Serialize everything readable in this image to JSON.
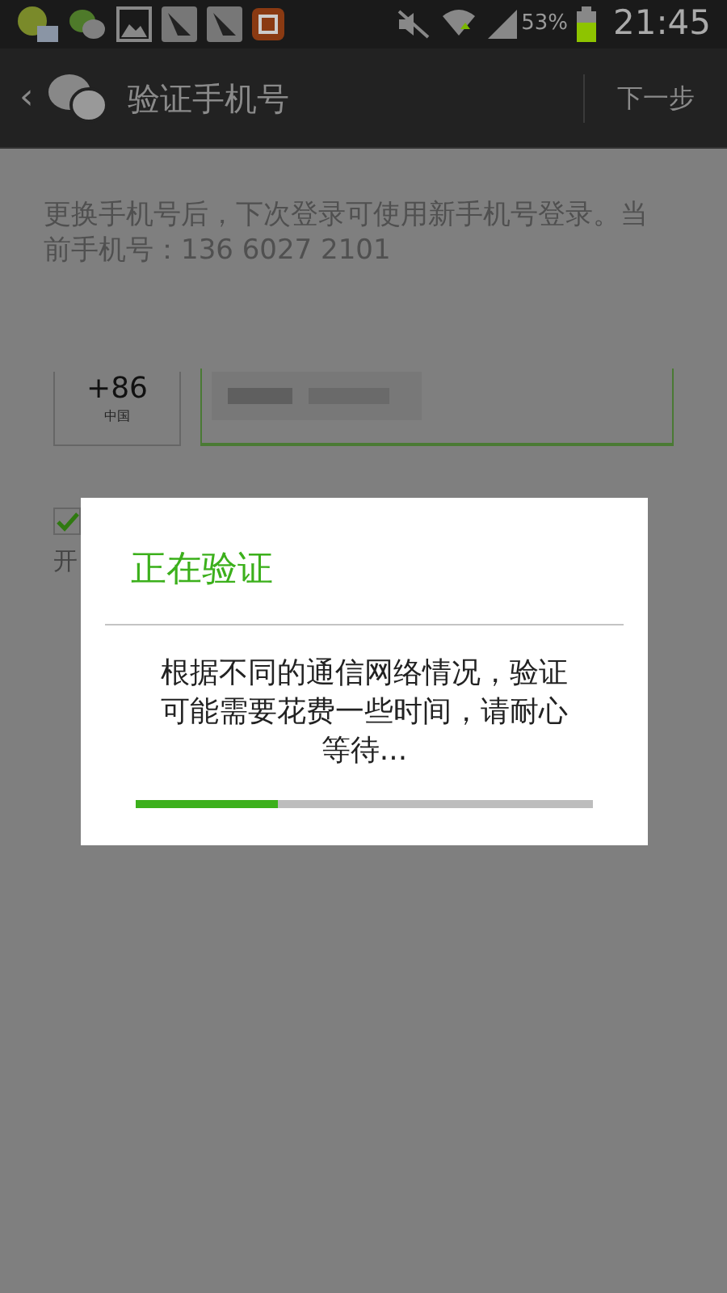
{
  "status_bar": {
    "battery_percent": "53%",
    "time": "21:45"
  },
  "action_bar": {
    "back": "‹",
    "title": "验证手机号",
    "next": "下一步"
  },
  "description": "更换手机号后，下次登录可使用新手机号登录。当前手机号：136 6027 2101",
  "country": {
    "code": "+86",
    "name": "中国"
  },
  "search_option": {
    "checked": true,
    "hint_fragment": "开"
  },
  "dialog": {
    "title": "正在验证",
    "message": "根据不同的通信网络情况，验证可能需要花费一些时间，请耐心等待...",
    "level": 0.31
  }
}
